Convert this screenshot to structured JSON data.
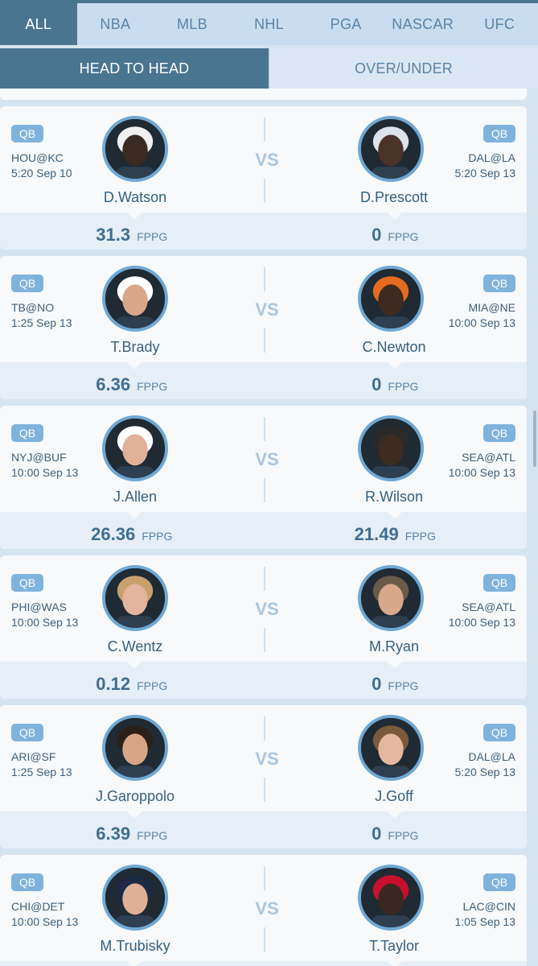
{
  "sport_tabs": [
    "ALL",
    "NBA",
    "MLB",
    "NHL",
    "PGA",
    "NASCAR",
    "UFC"
  ],
  "mode_tabs": {
    "head_to_head": "HEAD TO HEAD",
    "over_under": "OVER/UNDER"
  },
  "unit": "FPPG",
  "vs_label": "VS",
  "colors": {
    "accent": "#4a7591",
    "badge": "#7fb3dc",
    "text": "#35607f"
  },
  "matchups": [
    {
      "left": {
        "pos": "QB",
        "game": "HOU@KC",
        "time": "5:20 Sep 10",
        "name": "D.Watson",
        "fppg": "31.3",
        "skin": "#3a2a22",
        "helmet": "#f0f0f0"
      },
      "right": {
        "pos": "QB",
        "game": "DAL@LA",
        "time": "5:20 Sep 13",
        "name": "D.Prescott",
        "fppg": "0",
        "skin": "#4a3328",
        "helmet": "#dde3ea"
      }
    },
    {
      "left": {
        "pos": "QB",
        "game": "TB@NO",
        "time": "1:25 Sep 13",
        "name": "T.Brady",
        "fppg": "6.36",
        "skin": "#d9a78a",
        "helmet": "#ffffff"
      },
      "right": {
        "pos": "QB",
        "game": "MIA@NE",
        "time": "10:00 Sep 13",
        "name": "C.Newton",
        "fppg": "0",
        "skin": "#3d2a20",
        "helmet": "#e56b1f"
      }
    },
    {
      "left": {
        "pos": "QB",
        "game": "NYJ@BUF",
        "time": "10:00 Sep 13",
        "name": "J.Allen",
        "fppg": "26.36",
        "skin": "#e0b298",
        "helmet": "#ffffff"
      },
      "right": {
        "pos": "QB",
        "game": "SEA@ATL",
        "time": "10:00 Sep 13",
        "name": "R.Wilson",
        "fppg": "21.49",
        "skin": "#3e2c22",
        "helmet": "#2a2a2a"
      }
    },
    {
      "left": {
        "pos": "QB",
        "game": "PHI@WAS",
        "time": "10:00 Sep 13",
        "name": "C.Wentz",
        "fppg": "0.12",
        "skin": "#e3b59c",
        "helmet": "#c8a070"
      },
      "right": {
        "pos": "QB",
        "game": "SEA@ATL",
        "time": "10:00 Sep 13",
        "name": "M.Ryan",
        "fppg": "0",
        "skin": "#d8a88c",
        "helmet": "#6b5a48"
      }
    },
    {
      "left": {
        "pos": "QB",
        "game": "ARI@SF",
        "time": "1:25 Sep 13",
        "name": "J.Garoppolo",
        "fppg": "6.39",
        "skin": "#d7a585",
        "helmet": "#2b2018"
      },
      "right": {
        "pos": "QB",
        "game": "DAL@LA",
        "time": "5:20 Sep 13",
        "name": "J.Goff",
        "fppg": "0",
        "skin": "#e4b79e",
        "helmet": "#7a5a3a"
      }
    },
    {
      "left": {
        "pos": "QB",
        "game": "CHI@DET",
        "time": "10:00 Sep 13",
        "name": "M.Trubisky",
        "fppg": "",
        "skin": "#e0b096",
        "helmet": "#1c2a44"
      },
      "right": {
        "pos": "QB",
        "game": "LAC@CIN",
        "time": "1:05 Sep 13",
        "name": "T.Taylor",
        "fppg": "",
        "skin": "#3a2820",
        "helmet": "#c8102e"
      }
    }
  ]
}
